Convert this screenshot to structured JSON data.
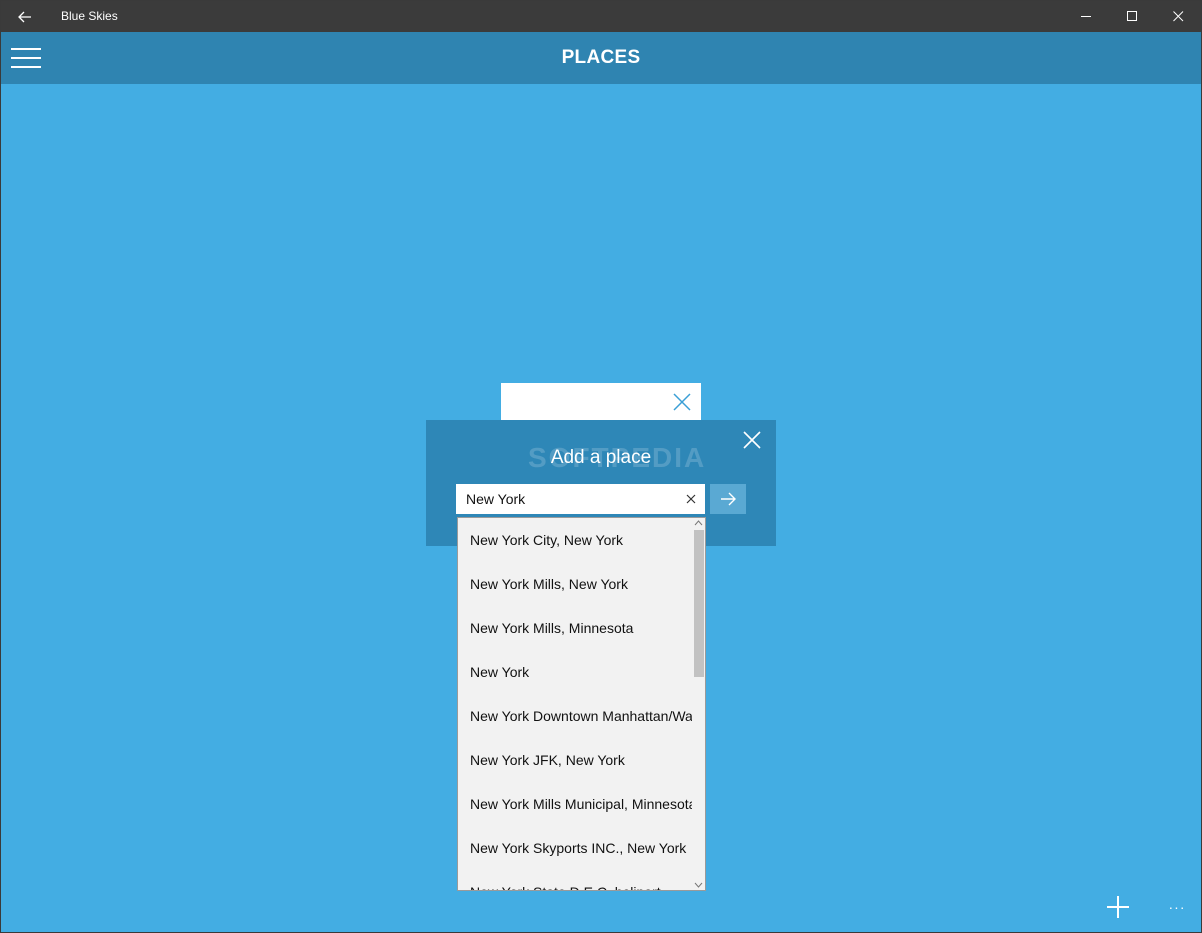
{
  "window": {
    "title": "Blue Skies",
    "back_icon": "back-arrow-icon",
    "controls": [
      "minimize-icon",
      "maximize-icon",
      "close-icon"
    ]
  },
  "header": {
    "title": "PLACES",
    "menu_icon": "hamburger-icon"
  },
  "dialog": {
    "title": "Add a place",
    "watermark": "SOFTPEDIA",
    "search": {
      "value": "New York",
      "placeholder": ""
    },
    "go_icon": "arrow-right-icon"
  },
  "suggestions": [
    "New York City, New York",
    "New York Mills, New York",
    "New York Mills, Minnesota",
    "New York",
    "New York Downtown Manhattan/Wall Street, New York",
    "New York JFK, New York",
    "New York Mills Municipal, Minnesota",
    "New York Skyports INC., New York",
    "New York State D.E.C. heliport"
  ],
  "bottom_bar": {
    "add_icon": "plus-icon",
    "more_label": "···"
  },
  "colors": {
    "background": "#43ade3",
    "header": "#2f84b1",
    "titlebar": "#3b3b3b",
    "dialog": "#2e87b7"
  }
}
